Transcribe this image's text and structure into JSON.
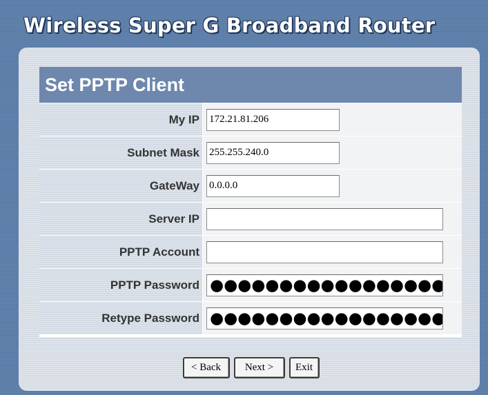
{
  "app": {
    "title": "Wireless Super G Broadband Router"
  },
  "form": {
    "title": "Set PPTP Client",
    "fields": [
      {
        "label": "My IP",
        "value": "172.21.81.206"
      },
      {
        "label": "Subnet Mask",
        "value": "255.255.240.0"
      },
      {
        "label": "GateWay",
        "value": "0.0.0.0"
      },
      {
        "label": "Server IP",
        "value": ""
      },
      {
        "label": "PPTP Account",
        "value": ""
      },
      {
        "label": "PPTP Password",
        "value": "●●●●●●●●●●●●●●●●●●"
      },
      {
        "label": "Retype Password",
        "value": "●●●●●●●●●●●●●●●●●●"
      }
    ]
  },
  "buttons": {
    "back": "< Back",
    "next": "Next >",
    "exit": "Exit"
  },
  "colors": {
    "background": "#5b7da8",
    "header": "#6d87ad",
    "label_cell": "#d3dae4"
  }
}
